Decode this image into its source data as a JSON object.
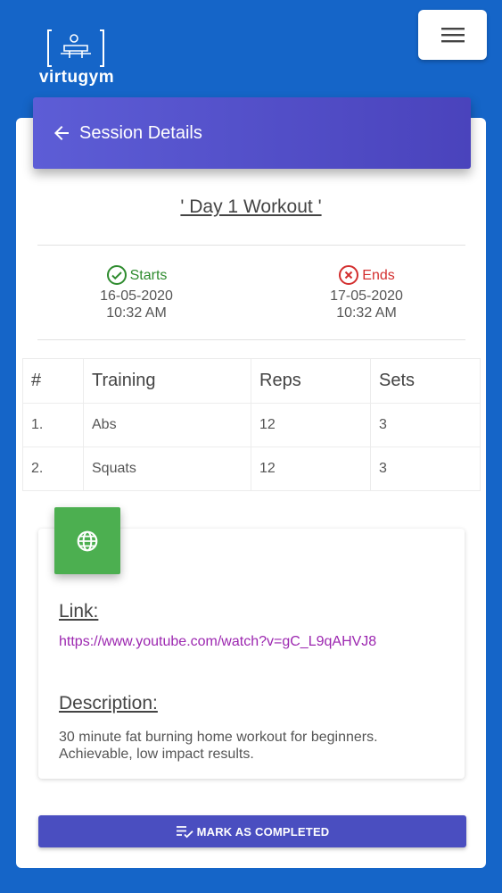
{
  "app": {
    "logo_text": "virtugym"
  },
  "header": {
    "title": "Session Details"
  },
  "session": {
    "title": "' Day 1 Workout '",
    "start": {
      "label": "Starts",
      "date": "16-05-2020",
      "time": "10:32 AM"
    },
    "end": {
      "label": "Ends",
      "date": "17-05-2020",
      "time": "10:32 AM"
    }
  },
  "table": {
    "headers": [
      "#",
      "Training",
      "Reps",
      "Sets"
    ],
    "rows": [
      [
        "1.",
        "Abs",
        "12",
        "3"
      ],
      [
        "2.",
        "Squats",
        "12",
        "3"
      ]
    ]
  },
  "info": {
    "link_label": "Link:",
    "link_url": "https://www.youtube.com/watch?v=gC_L9qAHVJ8",
    "description_label": "Description:",
    "description_text": "30 minute fat burning home workout for beginners. Achievable, low impact results."
  },
  "actions": {
    "mark_completed": "MARK AS COMPLETED"
  },
  "colors": {
    "background": "#1565c8",
    "header": "#4a43bc",
    "start": "#2e8b2e",
    "end": "#d32f2f",
    "globe_box": "#4caf50",
    "link": "#9c27b0",
    "button": "#4a4ec0"
  },
  "icons": {
    "logo": "gym-bench-logo-icon",
    "menu": "hamburger-menu-icon",
    "back": "arrow-back-icon",
    "start": "check-circle-icon",
    "end": "cancel-circle-icon",
    "globe": "globe-icon",
    "mark": "playlist-check-icon"
  }
}
